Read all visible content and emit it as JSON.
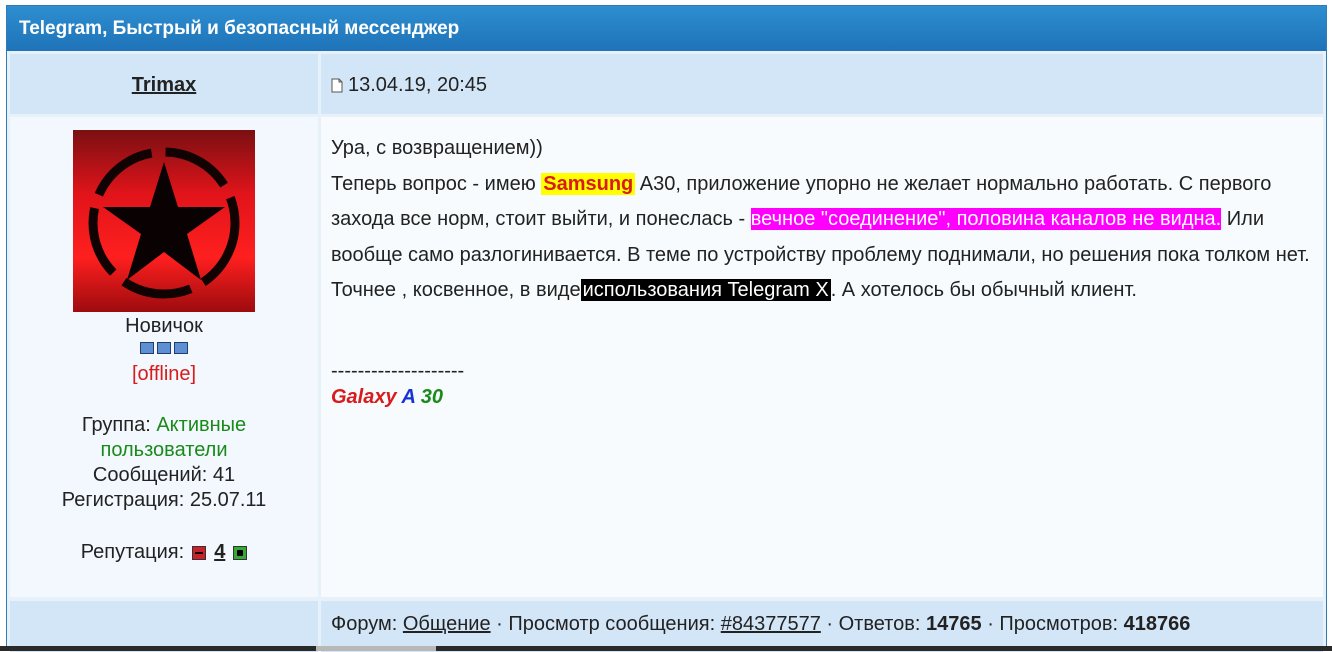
{
  "topic": {
    "title": "Telegram, Быстрый и безопасный мессенджер"
  },
  "post": {
    "author": "Trimax",
    "date": "13.04.19, 20:45",
    "user": {
      "rank": "Новичок",
      "status": "[offline]",
      "group_label": "Группа:",
      "group_value1": "Активные",
      "group_value2": "пользователи",
      "messages": "Сообщений: 41",
      "registration": "Регистрация: 25.07.11",
      "reputation_label": "Репутация:",
      "reputation_value": "4"
    },
    "body": {
      "line1": "Ура, с возвращением))",
      "p1": "Теперь вопрос - имею ",
      "samsung": "Samsung",
      "p2": " A30, приложение упорно не желает нормально работать. С первого захода все норм, стоит выйти, и понеслась - ",
      "pink": "вечное \"соединение\", половина каналов не видна.",
      "p3": " Или вообще само разлогинивается. В теме по устройству проблему поднимали, но решения пока толком нет. Точнее , косвенное, в виде",
      "black": "использования Telegram X",
      "p4": ". А хотелось бы обычный клиент."
    },
    "signature": {
      "separator": "--------------------",
      "part1": "Galaxy",
      "part2": "A",
      "part3": "30"
    },
    "footer": {
      "forum_label": "Форум:",
      "forum_link": "Общение",
      "view_label": "· Просмотр сообщения:",
      "view_link": "#84377577",
      "replies_label": "· Ответов:",
      "replies_value": "14765",
      "views_label": "· Просмотров:",
      "views_value": "418766"
    }
  },
  "colors": {
    "title_bar": "#1f73b8",
    "highlight_yellow": "#ffff00",
    "highlight_pink": "#ff00ff",
    "status_red": "#d81b1b",
    "group_green": "#1a8a1a"
  }
}
